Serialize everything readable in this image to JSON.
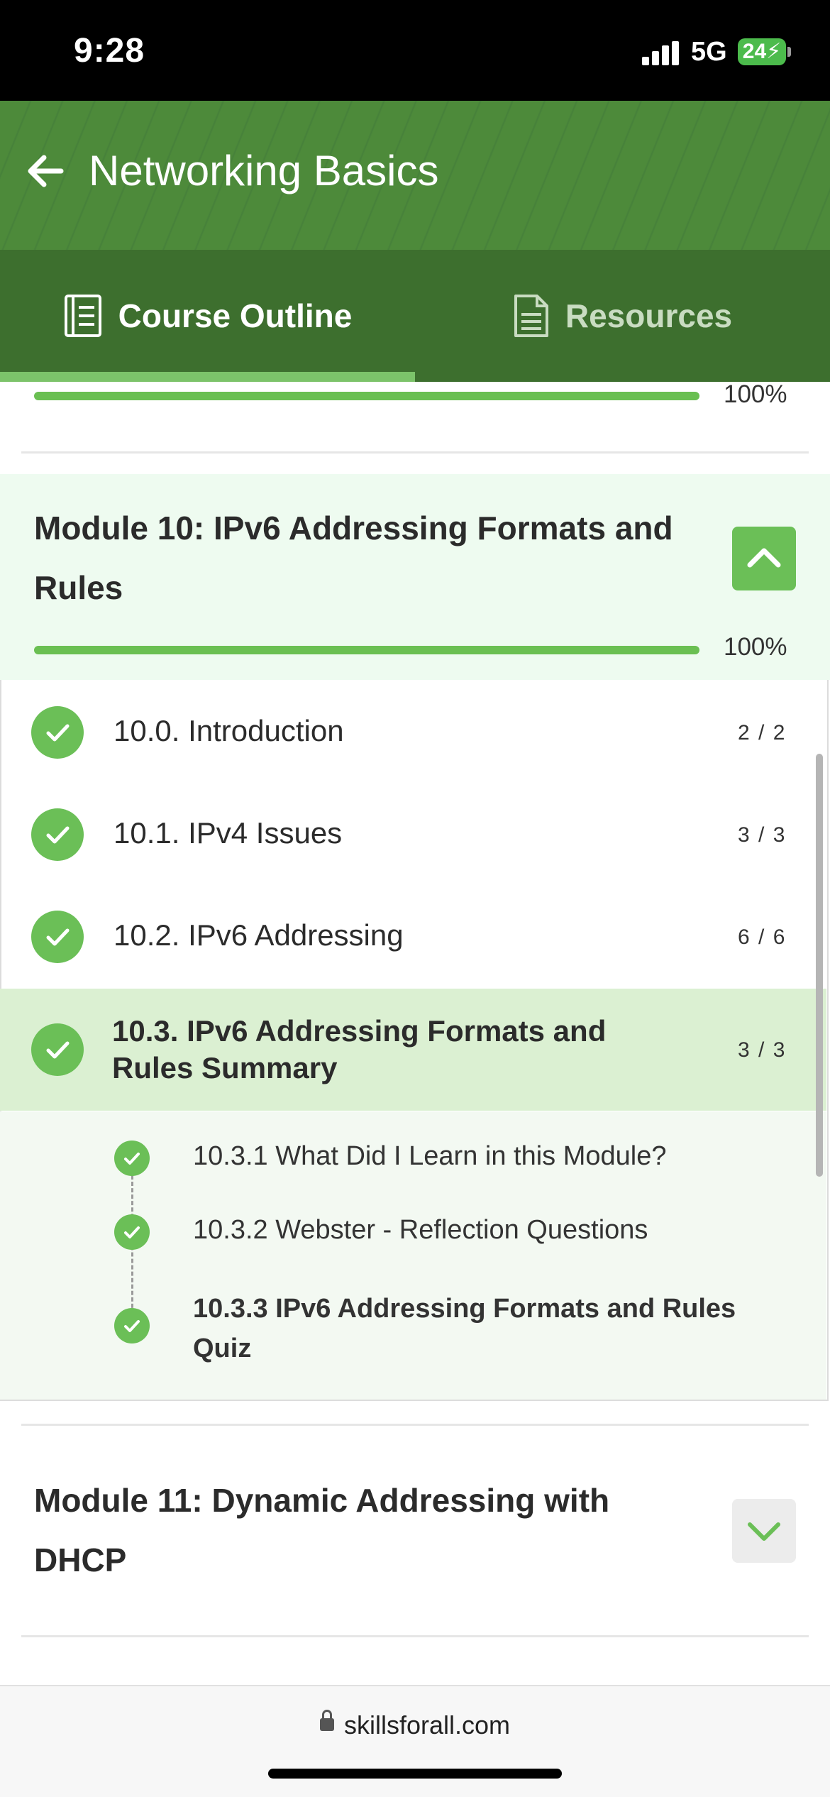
{
  "status_bar": {
    "time": "9:28",
    "network": "5G",
    "battery": "24"
  },
  "header": {
    "title": "Networking Basics"
  },
  "tabs": [
    {
      "label": "Course Outline",
      "active": true
    },
    {
      "label": "Resources",
      "active": false
    }
  ],
  "prev_module": {
    "progress": 1.0,
    "progress_text": "100%"
  },
  "module10": {
    "title_line1": "Module 10: IPv6 Addressing Formats and",
    "title_line2": "Rules",
    "progress": 1.0,
    "progress_text": "100%",
    "expanded": true,
    "lessons": [
      {
        "title": "10.0. Introduction",
        "count": "2 / 2",
        "completed": true
      },
      {
        "title": "10.1. IPv4 Issues",
        "count": "3 / 3",
        "completed": true
      },
      {
        "title": "10.2. IPv6 Addressing",
        "count": "6 / 6",
        "completed": true
      },
      {
        "title_line1": "10.3. IPv6 Addressing Formats and",
        "title_line2": "Rules Summary",
        "count": "3 / 3",
        "completed": true,
        "active": true
      }
    ],
    "sub_items": [
      {
        "title": "10.3.1 What Did I Learn in this Module?"
      },
      {
        "title": "10.3.2 Webster - Reflection Questions"
      },
      {
        "title_line1": "10.3.3 IPv6 Addressing Formats and Rules",
        "title_line2": "Quiz",
        "current": true
      }
    ]
  },
  "module11": {
    "title_line1": "Module 11: Dynamic Addressing with",
    "title_line2": "DHCP",
    "expanded": false
  },
  "browser": {
    "url": "skillsforall.com"
  },
  "colors": {
    "brand_green": "#4d8a3a",
    "accent_green": "#6bbf57",
    "active_row": "#dbf0d2",
    "module_bg": "#eefbf0"
  }
}
